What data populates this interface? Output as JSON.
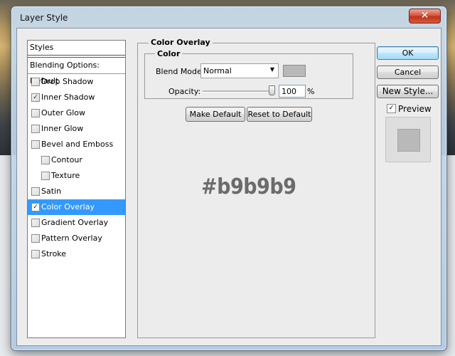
{
  "window": {
    "title": "Layer Style",
    "close_glyph": "✕"
  },
  "styles_panel": {
    "header": "Styles",
    "blending_options": "Blending Options: Default",
    "items": [
      {
        "label": "Drop Shadow",
        "checked": false,
        "sub": false,
        "selected": false
      },
      {
        "label": "Inner Shadow",
        "checked": true,
        "sub": false,
        "selected": false
      },
      {
        "label": "Outer Glow",
        "checked": false,
        "sub": false,
        "selected": false
      },
      {
        "label": "Inner Glow",
        "checked": false,
        "sub": false,
        "selected": false
      },
      {
        "label": "Bevel and Emboss",
        "checked": false,
        "sub": false,
        "selected": false
      },
      {
        "label": "Contour",
        "checked": false,
        "sub": true,
        "selected": false
      },
      {
        "label": "Texture",
        "checked": false,
        "sub": true,
        "selected": false
      },
      {
        "label": "Satin",
        "checked": false,
        "sub": false,
        "selected": false
      },
      {
        "label": "Color Overlay",
        "checked": true,
        "sub": false,
        "selected": true
      },
      {
        "label": "Gradient Overlay",
        "checked": false,
        "sub": false,
        "selected": false
      },
      {
        "label": "Pattern Overlay",
        "checked": false,
        "sub": false,
        "selected": false
      },
      {
        "label": "Stroke",
        "checked": false,
        "sub": false,
        "selected": false
      }
    ]
  },
  "color_overlay": {
    "group_title": "Color Overlay",
    "inner_title": "Color",
    "blend_mode_label": "Blend Mode:",
    "blend_mode_value": "Normal",
    "swatch_color": "#b9b9b9",
    "opacity_label": "Opacity:",
    "opacity_value": "100",
    "opacity_unit": "%",
    "make_default": "Make Default",
    "reset_default": "Reset to Default",
    "hex_caption": "#b9b9b9"
  },
  "actions": {
    "ok": "OK",
    "cancel": "Cancel",
    "new_style": "New Style...",
    "preview_label": "Preview",
    "preview_checked": true
  },
  "icons": {
    "checkmark": "✓",
    "dropdown_arrow": "▼"
  }
}
